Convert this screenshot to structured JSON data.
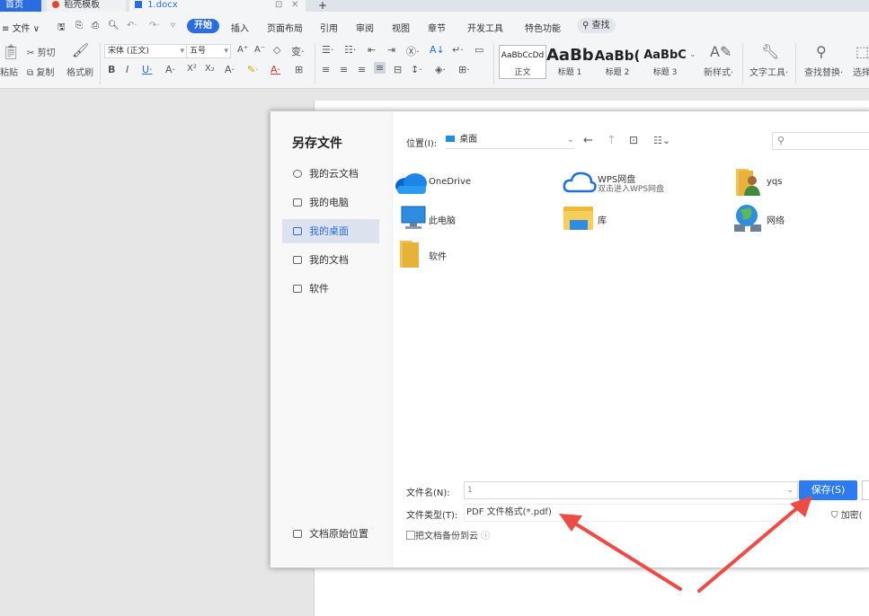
{
  "tabs": [
    {
      "label": "首页"
    },
    {
      "label": "稻壳模板"
    },
    {
      "label": "1.docx"
    }
  ],
  "menu": {
    "file": "文件",
    "start": "开始",
    "items": [
      "插入",
      "页面布局",
      "引用",
      "审阅",
      "视图",
      "章节",
      "开发工具",
      "特色功能"
    ],
    "search": "查找"
  },
  "ribbon": {
    "cut": "剪切",
    "paste": "粘贴",
    "copy": "复制",
    "format_painter": "格式刷",
    "font_name": "宋体 (正文)",
    "font_size": "五号",
    "styles": [
      {
        "preview": "AaBbCcDd",
        "caption": "正文"
      },
      {
        "preview": "AaBb",
        "caption": "标题 1"
      },
      {
        "preview": "AaBb(",
        "caption": "标题 2"
      },
      {
        "preview": "AaBbC",
        "caption": "标题 3"
      }
    ],
    "new_style": "新样式",
    "text_tools": "文字工具",
    "find_replace": "查找替换",
    "select": "选择"
  },
  "dialog": {
    "title": "另存文件",
    "location_label": "位置(I):",
    "location_value": "桌面",
    "sidebar": [
      {
        "label": "我的云文档",
        "icon": "cloud-doc-icon"
      },
      {
        "label": "我的电脑",
        "icon": "computer-icon"
      },
      {
        "label": "我的桌面",
        "icon": "desktop-icon",
        "active": true
      },
      {
        "label": "我的文档",
        "icon": "documents-icon"
      },
      {
        "label": "软件",
        "icon": "folder-icon"
      }
    ],
    "original_location": "文档原始位置",
    "files": [
      {
        "label": "OneDrive",
        "icon": "onedrive-icon"
      },
      {
        "label": "WPS网盘",
        "sub": "双击进入WPS网盘",
        "icon": "wps-cloud-icon"
      },
      {
        "label": "yqs",
        "icon": "user-folder-icon"
      },
      {
        "label": "此电脑",
        "icon": "this-pc-icon"
      },
      {
        "label": "库",
        "icon": "library-icon"
      },
      {
        "label": "网络",
        "icon": "network-icon"
      },
      {
        "label": "软件",
        "icon": "folder-icon"
      }
    ],
    "filename_label": "文件名(N):",
    "filename_value": "1",
    "filetype_label": "文件类型(T):",
    "filetype_value": "PDF 文件格式(*.pdf)",
    "save_button": "保存(S)",
    "encrypt": "加密(",
    "backup_cloud": "把文档备份到云"
  },
  "colors": {
    "accent": "#2d7bf0",
    "arrow": "#ef4b45",
    "start_tab": "#2b6de0"
  }
}
